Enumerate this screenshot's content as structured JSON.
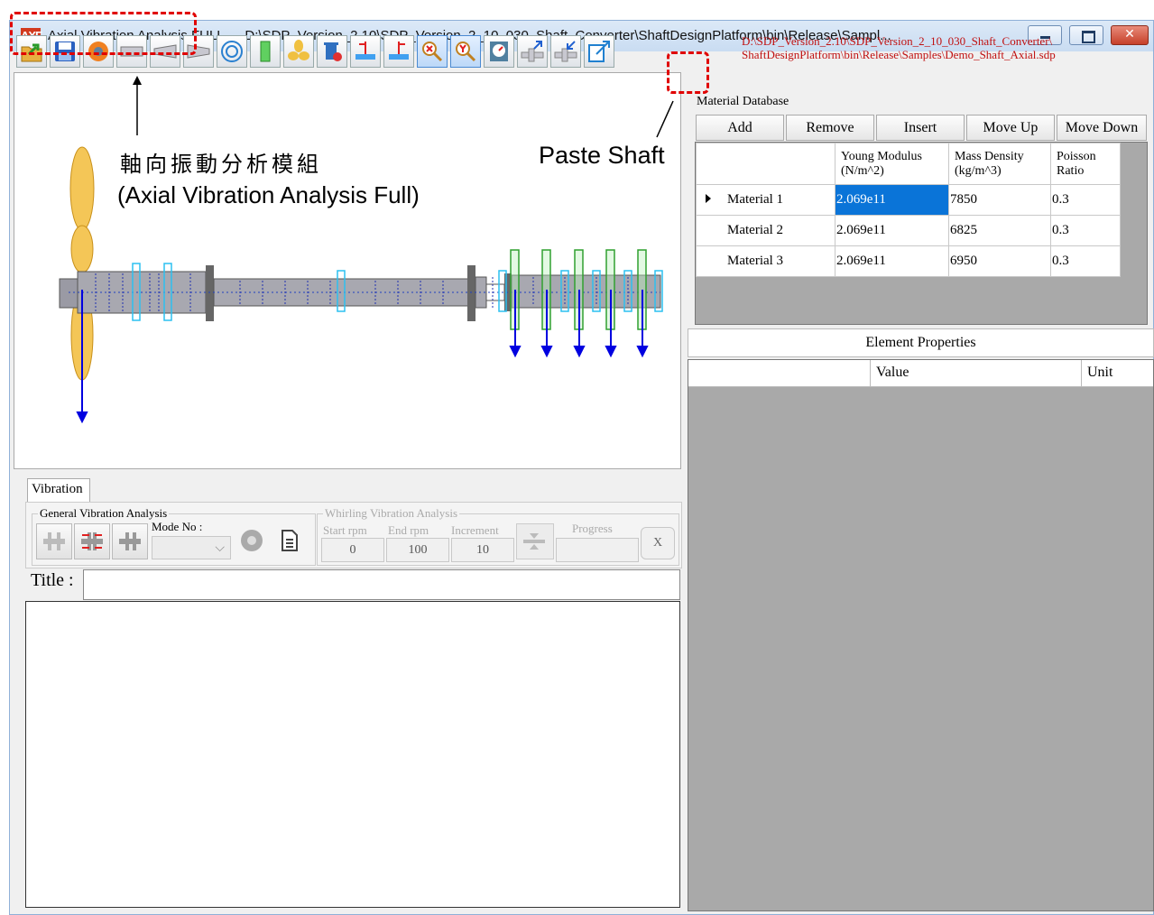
{
  "window": {
    "app_icon": "AXF",
    "title": "Axial Vibration Analysis FULL --- D:\\SDP_Version_2.10\\SDP_Version_2_10_030_Shaft_Converter\\ShaftDesignPlatform\\bin\\Release\\Sampl..."
  },
  "toolbar": {
    "file_path_line1": "D:\\SDP_Version_2.10\\SDP_Version_2_10_030_Shaft_Converter\\",
    "file_path_line2": "ShaftDesignPlatform\\bin\\Release\\Samples\\Demo_Shaft_Axial.sdp",
    "buttons": [
      "open-icon",
      "save-icon",
      "settings-globe-icon",
      "shaft-icon",
      "taper-left-icon",
      "taper-right-icon",
      "bearing-icon",
      "disk-icon",
      "propeller-icon",
      "delete-icon",
      "insert-left-icon",
      "insert-right-icon",
      "zoom-x-icon",
      "zoom-y-icon",
      "scale-icon",
      "copy-shaft-icon",
      "paste-shaft-icon",
      "export-icon"
    ]
  },
  "annotations": {
    "chinese_label": "軸向振動分析模組",
    "english_label": "(Axial Vibration Analysis Full)",
    "paste_label": "Paste Shaft"
  },
  "vibration": {
    "tab": "Vibration",
    "general_title": "General Vibration Analysis",
    "mode_no_label": "Mode No :",
    "whirling_title": "Whirling Vibration Analysis",
    "start_rpm_label": "Start rpm",
    "end_rpm_label": "End rpm",
    "increment_label": "Increment",
    "progress_label": "Progress",
    "start_rpm": "0",
    "end_rpm": "100",
    "increment": "10",
    "cancel_label": "X",
    "title_label": "Title :"
  },
  "material_db": {
    "label": "Material Database",
    "buttons": {
      "add": "Add",
      "remove": "Remove",
      "insert": "Insert",
      "move_up": "Move Up",
      "move_down": "Move Down"
    },
    "columns": [
      "Young Modulus (N/m^2)",
      "Mass Density (kg/m^3)",
      "Poisson Ratio"
    ],
    "col_young_1": "Young Modulus",
    "col_young_2": "(N/m^2)",
    "col_density_1": "Mass Density",
    "col_density_2": "(kg/m^3)",
    "col_poisson_1": "Poisson",
    "col_poisson_2": "Ratio",
    "rows": [
      {
        "name": "Material 1",
        "young": "2.069e11",
        "density": "7850",
        "poisson": "0.3"
      },
      {
        "name": "Material 2",
        "young": "2.069e11",
        "density": "6825",
        "poisson": "0.3"
      },
      {
        "name": "Material 3",
        "young": "2.069e11",
        "density": "6950",
        "poisson": "0.3"
      }
    ]
  },
  "element_props": {
    "header": "Element Properties",
    "col_value": "Value",
    "col_unit": "Unit"
  },
  "colors": {
    "shaft": "#a8a8b0",
    "propeller": "#f0c040",
    "bearing": "#3cc8f0",
    "mass": "#40c040",
    "force_arrow": "#0000e0",
    "annotation_red": "#e00000",
    "selection": "#0a74d8"
  }
}
